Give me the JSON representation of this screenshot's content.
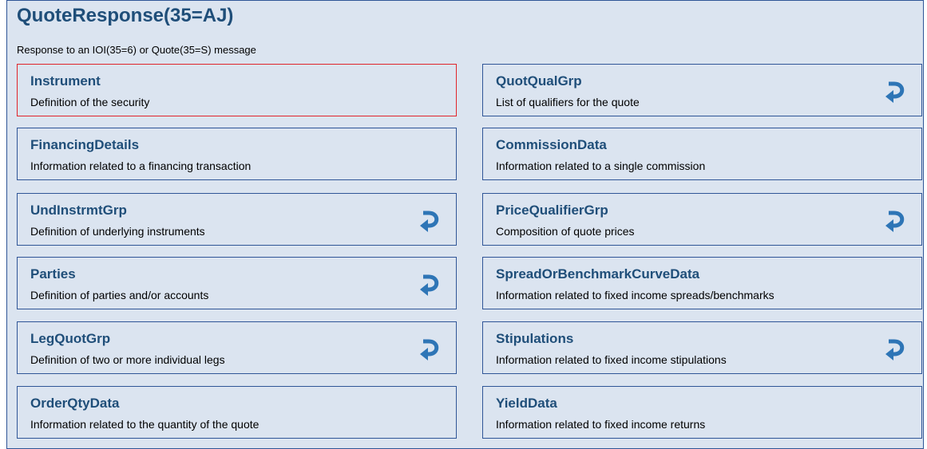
{
  "title": "QuoteResponse(35=AJ)",
  "subtitle": "Response to an IOI(35=6) or Quote(35=S) message",
  "colors": {
    "panel_background": "#dbe4f0",
    "border": "#2f5597",
    "title_text": "#1f4e79",
    "selected_border": "#e0242a",
    "repeat_icon": "#2e75b6"
  },
  "left_column": [
    {
      "name": "Instrument",
      "description": "Definition of the security",
      "repeating": false,
      "selected": true
    },
    {
      "name": "FinancingDetails",
      "description": "Information related to a financing transaction",
      "repeating": false,
      "selected": false
    },
    {
      "name": "UndInstrmtGrp",
      "description": "Definition of underlying instruments",
      "repeating": true,
      "selected": false
    },
    {
      "name": "Parties",
      "description": "Definition of parties and/or accounts",
      "repeating": true,
      "selected": false
    },
    {
      "name": "LegQuotGrp",
      "description": "Definition of two or more individual legs",
      "repeating": true,
      "selected": false
    },
    {
      "name": "OrderQtyData",
      "description": "Information related to the quantity of the quote",
      "repeating": false,
      "selected": false
    }
  ],
  "right_column": [
    {
      "name": "QuotQualGrp",
      "description": "List of qualifiers for the quote",
      "repeating": true,
      "selected": false
    },
    {
      "name": "CommissionData",
      "description": "Information related to a single commission",
      "repeating": false,
      "selected": false
    },
    {
      "name": "PriceQualifierGrp",
      "description": "Composition of quote prices",
      "repeating": true,
      "selected": false
    },
    {
      "name": "SpreadOrBenchmarkCurveData",
      "description": "Information related to fixed income spreads/benchmarks",
      "repeating": false,
      "selected": false
    },
    {
      "name": "Stipulations",
      "description": "Information related to fixed income stipulations",
      "repeating": true,
      "selected": false
    },
    {
      "name": "YieldData",
      "description": "Information related to fixed income returns",
      "repeating": false,
      "selected": false
    }
  ]
}
